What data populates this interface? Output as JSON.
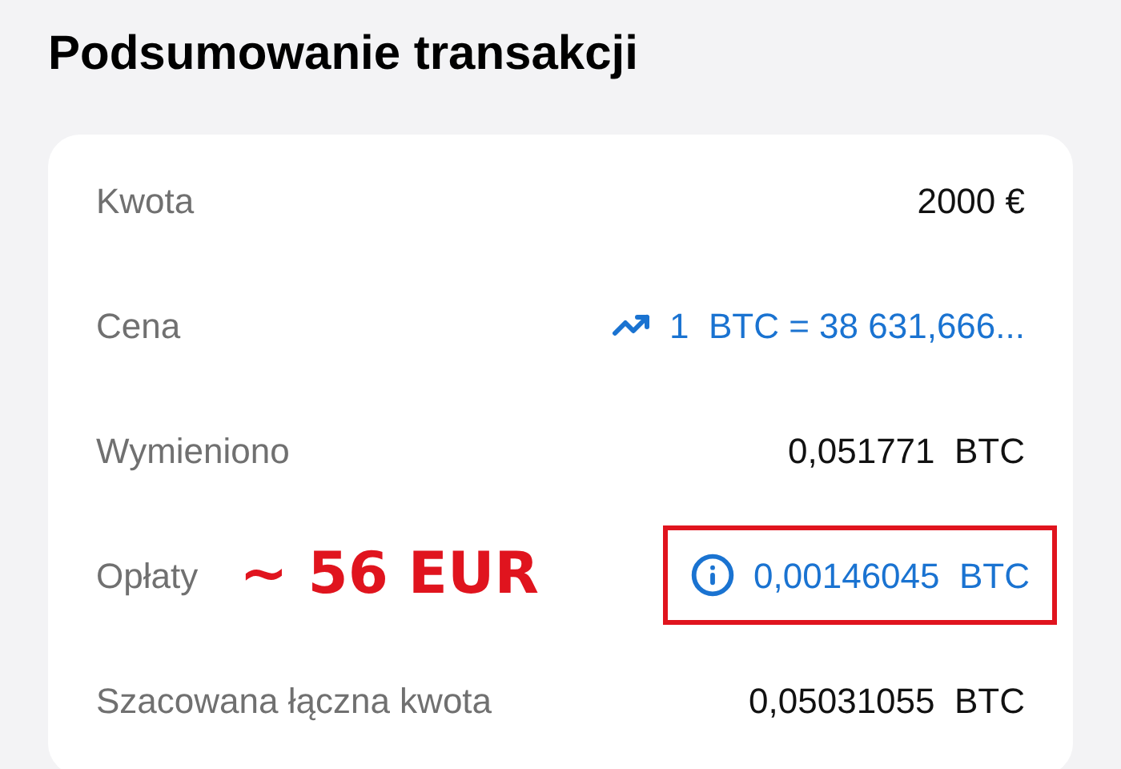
{
  "title": "Podsumowanie transakcji",
  "rows": [
    {
      "kind": "plain",
      "label": "Kwota",
      "value": "2000 €"
    },
    {
      "kind": "rate",
      "label": "Cena",
      "value": "1  BTC = 38 631,666..."
    },
    {
      "kind": "plain",
      "label": "Wymieniono",
      "value": "0,051771  BTC"
    },
    {
      "kind": "fee",
      "label": "Opłaty",
      "annotation": "~ 56 EUR",
      "value": "0,00146045  BTC"
    },
    {
      "kind": "plain",
      "label": "Szacowana łączna kwota",
      "value": "0,05031055  BTC"
    }
  ]
}
